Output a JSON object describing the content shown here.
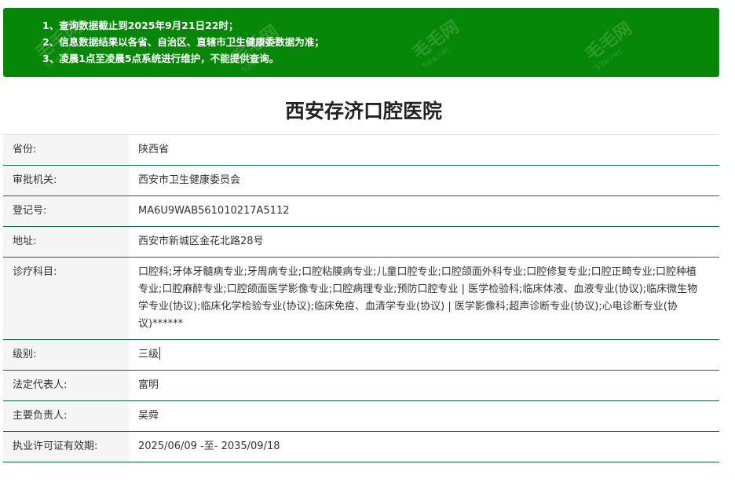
{
  "notice": {
    "lines": [
      "1、查询数据截止到2025年9月21日22时；",
      "2、信息数据结果以各省、自治区、直辖市卫生健康委数据为准；",
      "3、凌晨1点至凌晨5点系统进行维护，不能提供查询。"
    ],
    "watermark_text": "毛毛网",
    "watermark_sub": "59w.net"
  },
  "hospital": {
    "name": "西安存济口腔医院"
  },
  "fields": [
    {
      "label": "省份:",
      "value": "陕西省"
    },
    {
      "label": "审批机关:",
      "value": "西安市卫生健康委员会"
    },
    {
      "label": "登记号:",
      "value": "MA6U9WAB561010217A5112"
    },
    {
      "label": "地址:",
      "value": "西安市新城区金花北路28号"
    },
    {
      "label": "诊疗科目:",
      "value": "口腔科;牙体牙髓病专业;牙周病专业;口腔粘膜病专业;儿童口腔专业;口腔颌面外科专业;口腔修复专业;口腔正畸专业;口腔种植专业;口腔麻醉专业;口腔颌面医学影像专业;口腔病理专业;预防口腔专业 | 医学检验科;临床体液、血液专业(协议);临床微生物学专业(协议);临床化学检验专业(协议);临床免疫、血清学专业(协议) | 医学影像科;超声诊断专业(协议);心电诊断专业(协议)******"
    },
    {
      "label": "级别:",
      "value": "三级"
    },
    {
      "label": "法定代表人:",
      "value": "富明"
    },
    {
      "label": "主要负责人:",
      "value": "吴舜"
    },
    {
      "label": "执业许可证有效期:",
      "value": "2025/06/09 -至- 2035/09/18"
    }
  ],
  "colors": {
    "notice_bg": "#078707",
    "row_border": "#0c6b49",
    "label_bg": "#f5f5f5"
  }
}
